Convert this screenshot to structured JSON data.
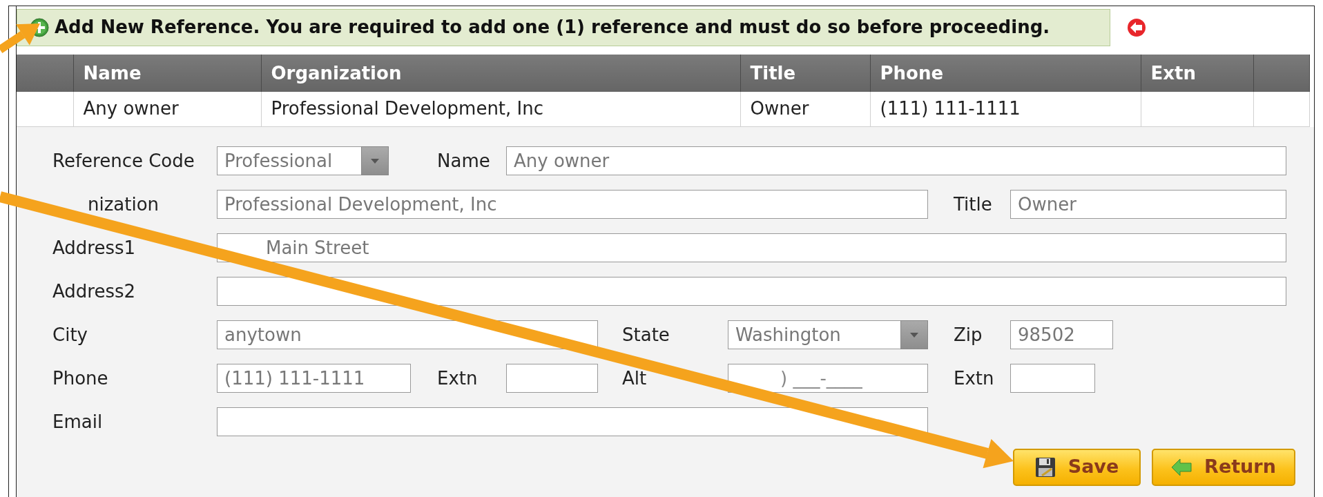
{
  "banner": {
    "text": "Add New Reference. You are required to add one (1) reference and must do so before proceeding."
  },
  "table": {
    "columns": [
      "Name",
      "Organization",
      "Title",
      "Phone",
      "Extn"
    ],
    "rows": [
      {
        "cells": [
          "Any owner",
          "Professional Development, Inc",
          "Owner",
          "(111) 111-1111"
        ],
        "selected": false
      }
    ]
  },
  "form": {
    "rows": [
      {
        "fields": [
          {
            "label": "Reference Code",
            "kind": "select",
            "value": "Professional"
          },
          {
            "label": "Name",
            "kind": "text",
            "value": "Any owner"
          }
        ]
      },
      {
        "fields": [
          {
            "label": "nization",
            "kind": "text",
            "value": "Professional Development, Inc"
          },
          {
            "label": "Title",
            "kind": "text",
            "value": "Owner"
          }
        ]
      },
      {
        "fields": [
          {
            "label": "Address1",
            "kind": "text",
            "value": "Main Street"
          }
        ]
      },
      {
        "fields": [
          {
            "label": "Address2",
            "kind": "text"
          }
        ]
      },
      {
        "fields": [
          {
            "label": "City",
            "kind": "text",
            "value": "anytown"
          },
          {
            "label": "State",
            "kind": "select",
            "value": "Washington"
          },
          {
            "label": "Zip",
            "kind": "text",
            "value": "98502"
          }
        ]
      },
      {
        "fields": [
          {
            "label": "Phone",
            "kind": "text",
            "value": "(111) 111-1111"
          },
          {
            "label": "Extn",
            "kind": "text"
          },
          {
            "label": "Alt",
            "kind": "text",
            "placeholder": ") ___-____"
          },
          {
            "label": "Extn",
            "kind": "text"
          }
        ]
      },
      {
        "fields": [
          {
            "label": "Email",
            "kind": "text"
          }
        ]
      }
    ]
  },
  "buttons": [
    {
      "label": "Save",
      "kind": "save"
    },
    {
      "label": "Return",
      "kind": "return"
    }
  ]
}
